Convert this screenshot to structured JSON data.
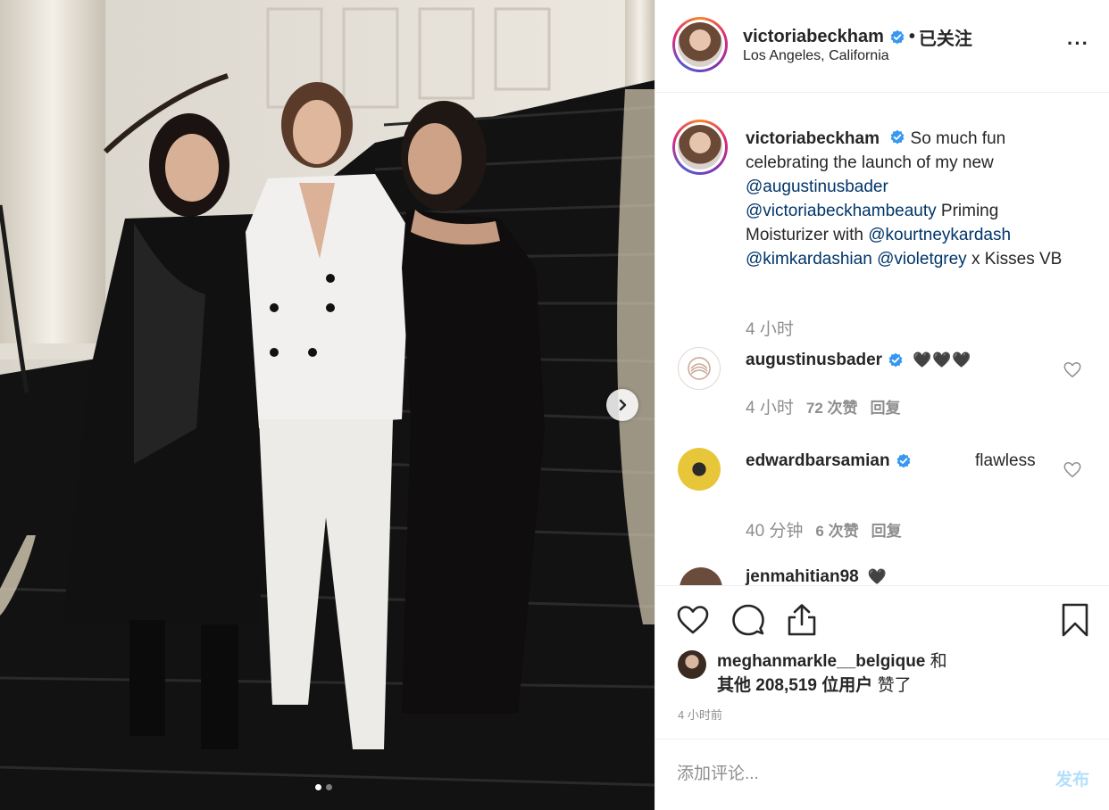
{
  "post": {
    "username": "victoriabeckham",
    "follow_separator": "•",
    "follow_state": "已关注",
    "location": "Los Angeles, California",
    "more_icon": "···"
  },
  "caption": {
    "username": "victoriabeckham",
    "text_1": "So much fun celebrating the launch of my new",
    "mention_1": "@augustinusbader",
    "mention_2": "@victoriabeckhambeauty",
    "text_2": "Priming Moisturizer with",
    "mention_3": "@kourtneykardash",
    "mention_4": "@kimkardashian",
    "mention_5": "@violetgrey",
    "text_3": "x Kisses VB",
    "time": "4 小时"
  },
  "comments": [
    {
      "username": "augustinusbader",
      "verified": true,
      "text": "🖤🖤🖤",
      "time": "4 小时",
      "likes": "72 次赞",
      "reply": "回复"
    },
    {
      "username": "edwardbarsamian",
      "verified": true,
      "text": "flawless",
      "time": "40 分钟",
      "likes": "6 次赞",
      "reply": "回复"
    },
    {
      "username": "jenmahitian98",
      "text": "🖤"
    }
  ],
  "likes": {
    "liker": "meghanmarkle__belgique",
    "and": "和",
    "others_prefix": "其他",
    "count": "208,519",
    "others_suffix": "位用户",
    "liked": "赞了"
  },
  "post_time": "4 小时前",
  "comment_box": {
    "placeholder": "添加评论...",
    "post_label": "发布"
  },
  "carousel": {
    "current": 1,
    "total": 2
  },
  "colors": {
    "link": "#003569",
    "verified": "#3897f0",
    "muted": "#8e8e8e",
    "post_disabled": "#b2dffc"
  },
  "icons": [
    "verified-badge-icon",
    "more-options-icon",
    "heart-icon",
    "comment-icon",
    "share-icon",
    "bookmark-icon",
    "chevron-right-icon"
  ]
}
